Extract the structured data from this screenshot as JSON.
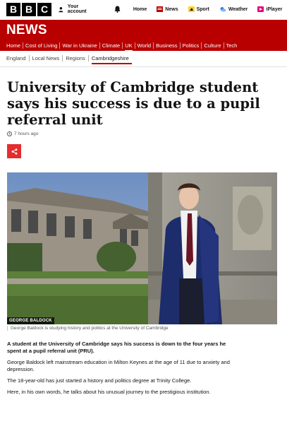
{
  "header": {
    "logo_letters": [
      "B",
      "B",
      "C"
    ],
    "account_label": "Your account",
    "nav": [
      {
        "label": "Home",
        "icon": "none"
      },
      {
        "label": "News",
        "icon": "news-icon"
      },
      {
        "label": "Sport",
        "icon": "sport-icon"
      },
      {
        "label": "Weather",
        "icon": "weather-icon"
      },
      {
        "label": "iPlayer",
        "icon": "iplayer-icon"
      }
    ]
  },
  "news": {
    "banner_title": "NEWS",
    "brand_color": "#b80000",
    "nav": [
      "Home",
      "Cost of Living",
      "War in Ukraine",
      "Climate",
      "UK",
      "World",
      "Business",
      "Politics",
      "Culture",
      "Tech"
    ],
    "active_nav": "UK",
    "subnav": [
      "England",
      "Local News",
      "Regions",
      "Cambridgeshire"
    ]
  },
  "article": {
    "headline": "University of Cambridge student says his success is due to a pupil referral unit",
    "timestamp": "7 hours ago",
    "photo_credit": "GEORGE BALDOCK",
    "caption": "George Baldock is studying history and politics at the University of Cambridge",
    "paragraphs": [
      "A student at the University of Cambridge says his success is down to the four years he spent at a pupil referral unit (PRU).",
      "George Baldock left mainstream education in Milton Keynes at the age of 11 due to anxiety and depression.",
      "The 18-year-old has just started a history and politics degree at Trinity College.",
      "Here, in his own words, he talks about his unusual journey to the prestigious institution."
    ]
  }
}
